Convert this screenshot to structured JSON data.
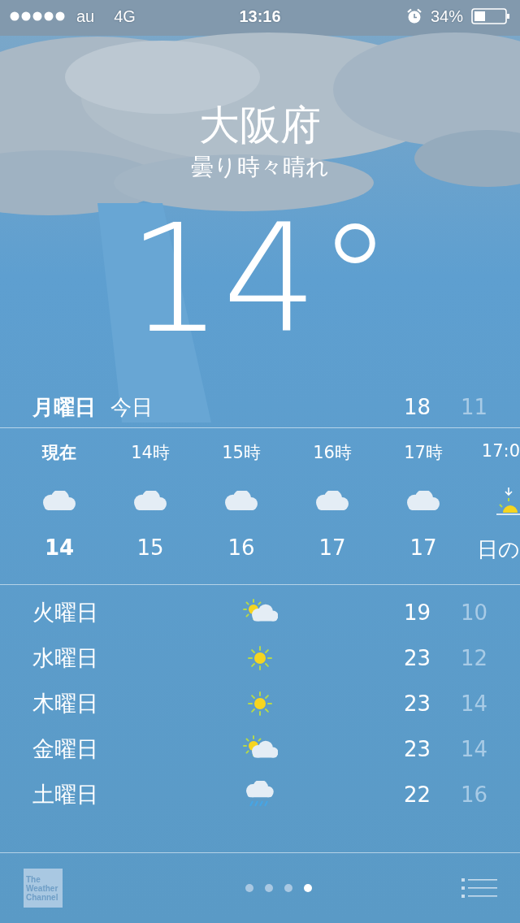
{
  "status_bar": {
    "carrier": "au",
    "network": "4G",
    "time": "13:16",
    "battery": "34%"
  },
  "location": {
    "city": "大阪府",
    "condition": "曇り時々晴れ",
    "temperature": "14°"
  },
  "today": {
    "day": "月曜日",
    "label": "今日",
    "high": "18",
    "low": "11"
  },
  "hourly": [
    {
      "time": "現在",
      "kind": "cloudy",
      "temp": "14",
      "now": true
    },
    {
      "time": "14時",
      "kind": "cloudy",
      "temp": "15",
      "now": false
    },
    {
      "time": "15時",
      "kind": "cloudy",
      "temp": "16",
      "now": false
    },
    {
      "time": "16時",
      "kind": "cloudy",
      "temp": "17",
      "now": false
    },
    {
      "time": "17時",
      "kind": "cloudy",
      "temp": "17",
      "now": false
    },
    {
      "time": "17:0",
      "kind": "sunset",
      "temp": "日の",
      "now": false
    }
  ],
  "daily": [
    {
      "day": "火曜日",
      "kind": "partly_cloudy",
      "high": "19",
      "low": "10"
    },
    {
      "day": "水曜日",
      "kind": "sunny",
      "high": "23",
      "low": "12"
    },
    {
      "day": "木曜日",
      "kind": "sunny",
      "high": "23",
      "low": "14"
    },
    {
      "day": "金曜日",
      "kind": "partly_cloudy",
      "high": "23",
      "low": "14"
    },
    {
      "day": "土曜日",
      "kind": "rain",
      "high": "22",
      "low": "16"
    }
  ],
  "footer": {
    "logo": "The Weather Channel",
    "pages": [
      {
        "selected": false
      },
      {
        "selected": false
      },
      {
        "selected": false
      },
      {
        "selected": true
      }
    ]
  }
}
